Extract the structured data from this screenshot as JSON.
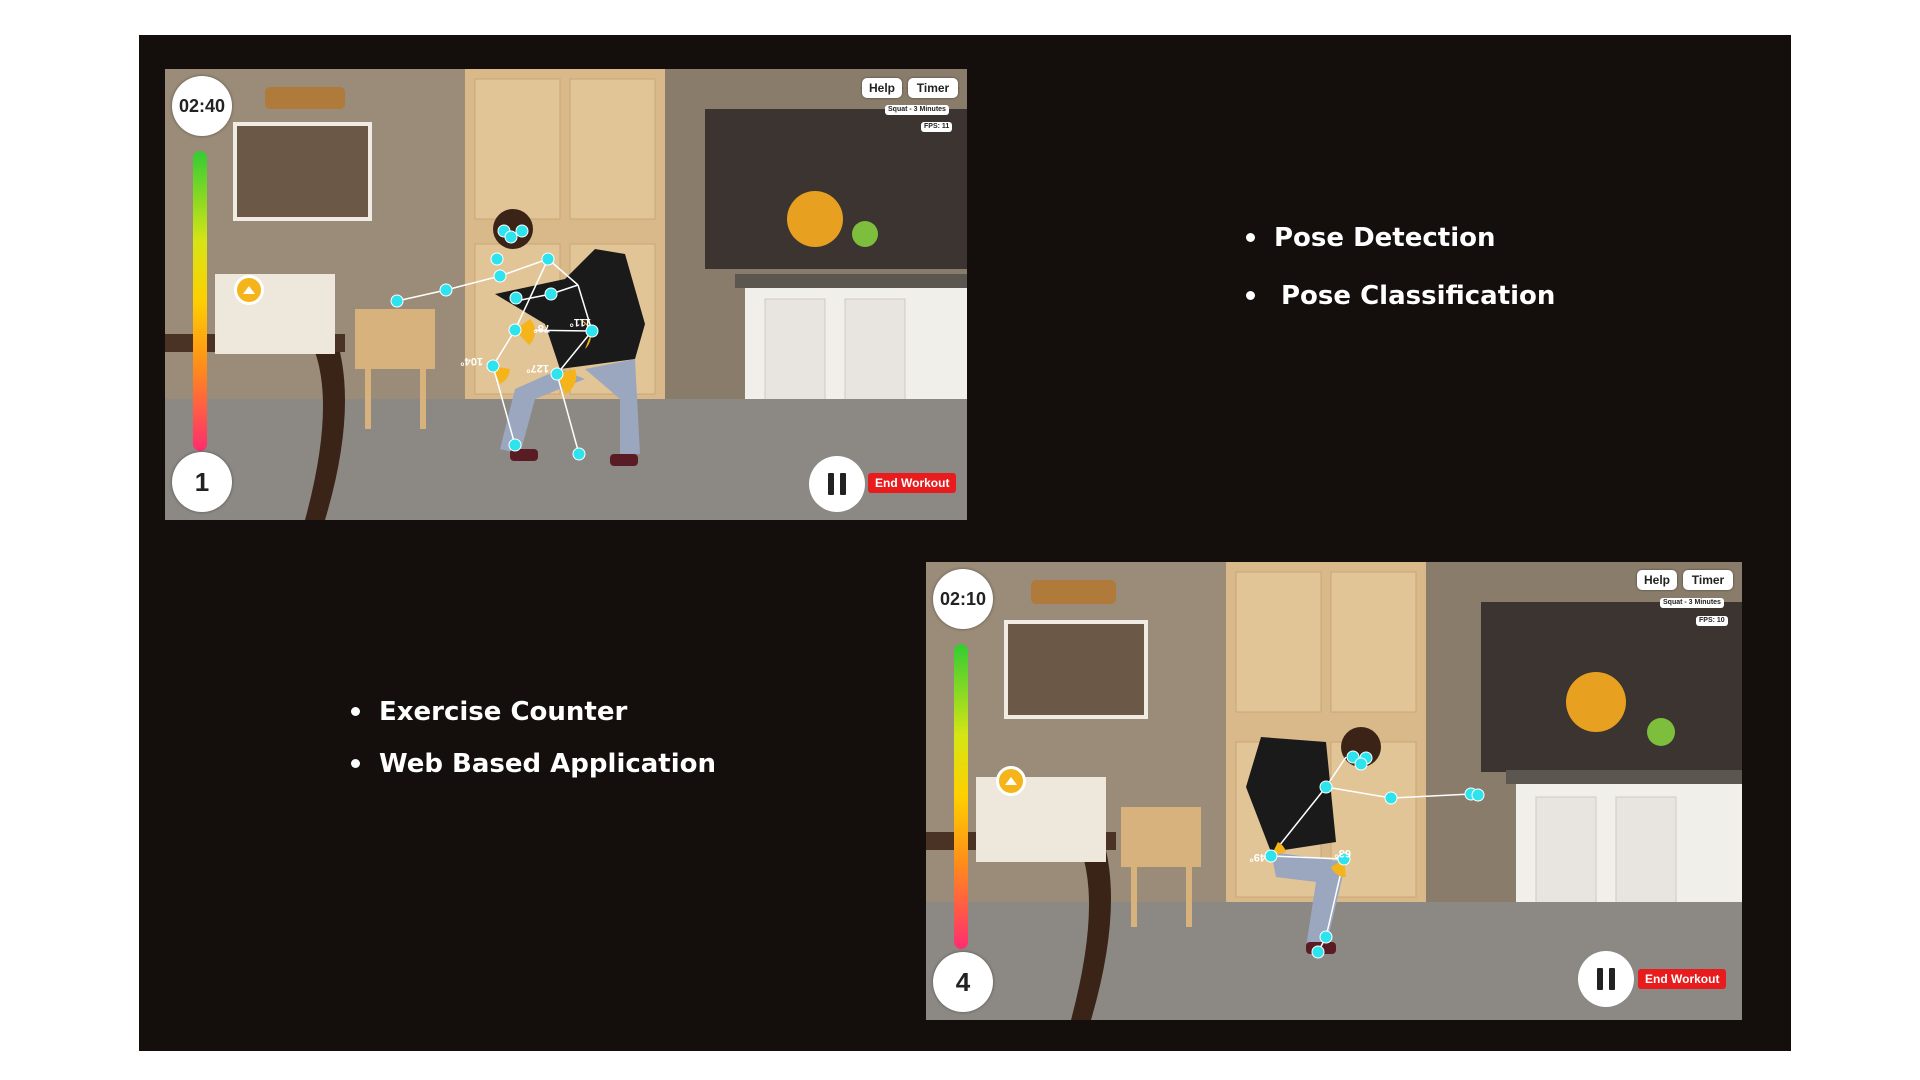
{
  "bullets_top": [
    "Pose Detection",
    "Pose Classification"
  ],
  "bullets_bottom": [
    "Exercise Counter",
    "Web Based Application"
  ],
  "screenshots": [
    {
      "timer": "02:40",
      "rep_count": "1",
      "help_label": "Help",
      "timer_label": "Timer",
      "workout_label": "Squat - 3 Minutes",
      "fps_label": "FPS: 11",
      "end_label": "End Workout",
      "angles": [
        "111°",
        "78°",
        "104°",
        "127°"
      ]
    },
    {
      "timer": "02:10",
      "rep_count": "4",
      "help_label": "Help",
      "timer_label": "Timer",
      "workout_label": "Squat - 3 Minutes",
      "fps_label": "FPS: 10",
      "end_label": "End Workout",
      "angles": [
        "49°",
        "63°"
      ]
    }
  ],
  "colors": {
    "background": "#140e0c",
    "keypoint": "#2de3ee",
    "angle_fill": "#f5b41a",
    "end_button": "#e81c1c"
  },
  "icons": [
    "pause-icon",
    "up-arrow-icon"
  ]
}
